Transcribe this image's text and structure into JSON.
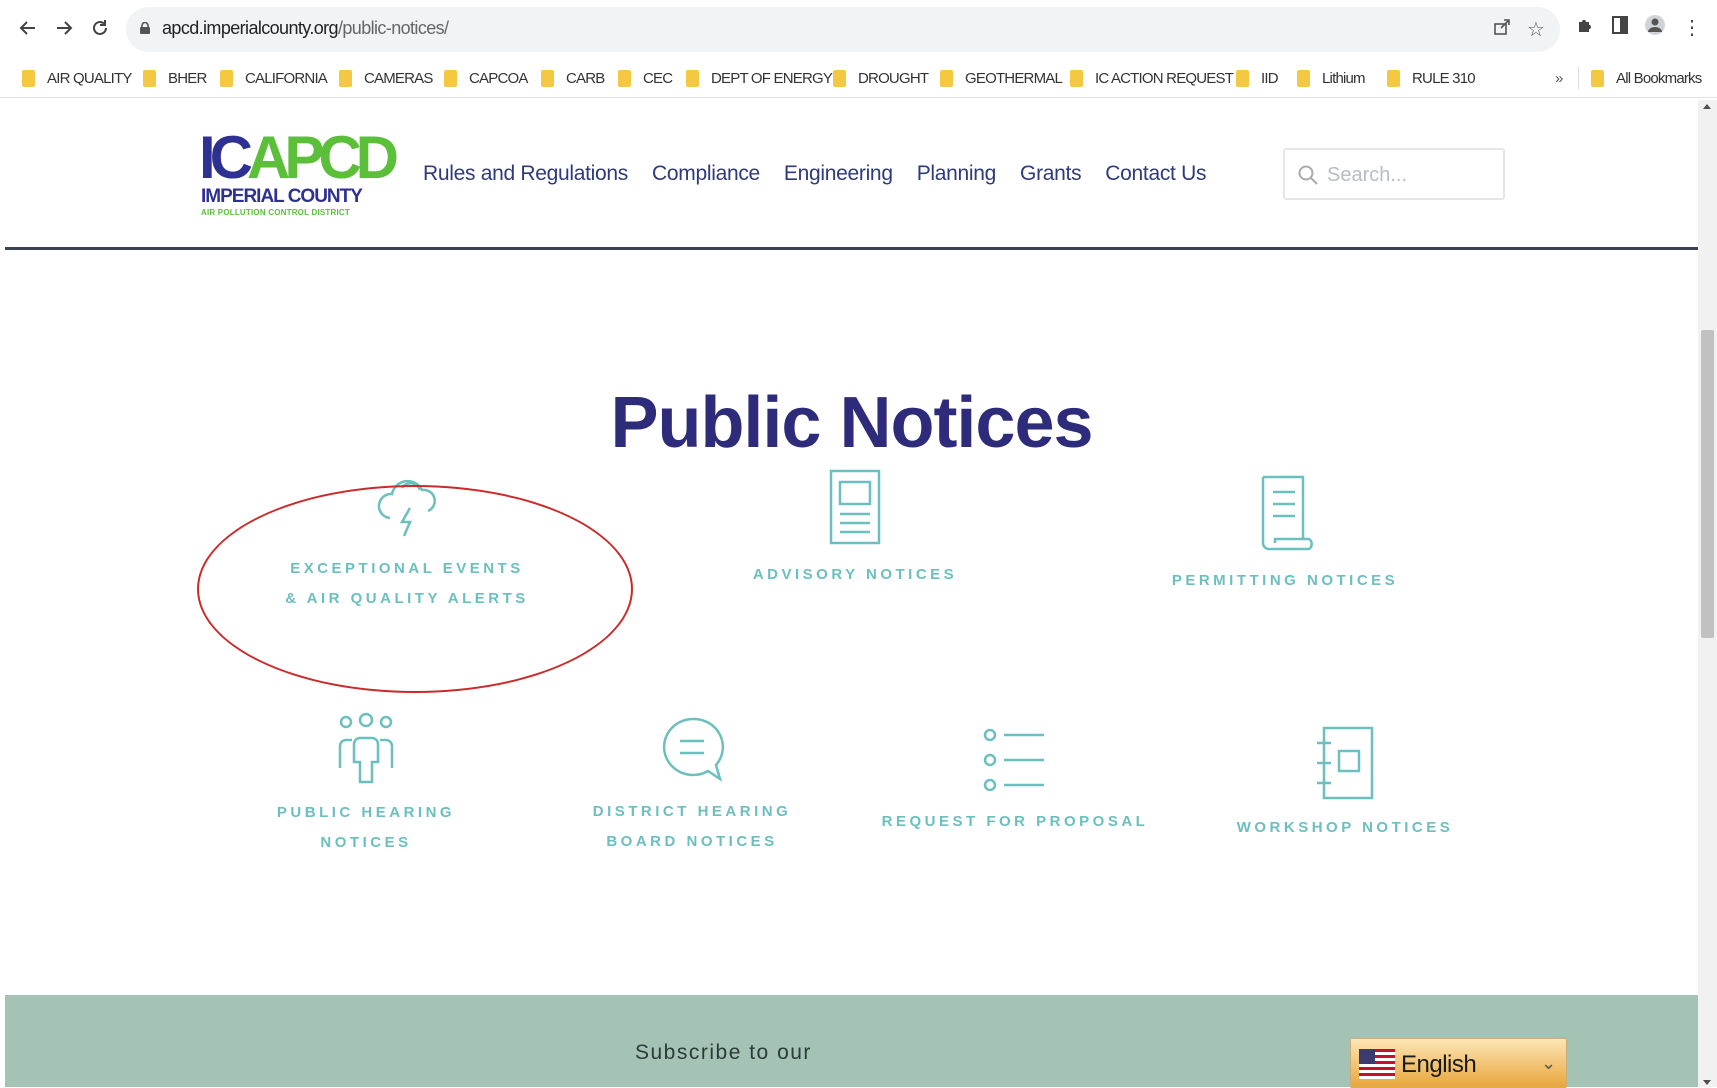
{
  "browser": {
    "url_domain": "apcd.imperialcounty.org",
    "url_path": "/public-notices/",
    "bookmarks": [
      "AIR QUALITY",
      "BHER",
      "CALIFORNIA",
      "CAMERAS",
      "CAPCOA",
      "CARB",
      "CEC",
      "DEPT OF ENERGY",
      "DROUGHT",
      "GEOTHERMAL",
      "IC ACTION REQUEST",
      "IID",
      "Lithium",
      "RULE 310"
    ],
    "overflow_label": "»",
    "all_bookmarks": "All Bookmarks"
  },
  "logo": {
    "mark_ic": "IC",
    "mark_apcd": "APCD",
    "name": "IMPERIAL COUNTY",
    "subtitle": "AIR POLLUTION CONTROL DISTRICT"
  },
  "nav": {
    "items": [
      "Rules and Regulations",
      "Compliance",
      "Engineering",
      "Planning",
      "Grants",
      "Contact Us"
    ]
  },
  "search": {
    "placeholder": "Search..."
  },
  "page": {
    "title": "Public Notices"
  },
  "notices": [
    {
      "line1": "EXCEPTIONAL EVENTS",
      "line2": "& AIR QUALITY ALERTS",
      "icon": "storm-cloud-icon"
    },
    {
      "line1": "ADVISORY NOTICES",
      "line2": "",
      "icon": "document-icon"
    },
    {
      "line1": "PERMITTING NOTICES",
      "line2": "",
      "icon": "scroll-document-icon"
    },
    {
      "line1": "PUBLIC HEARING",
      "line2": "NOTICES",
      "icon": "people-group-icon"
    },
    {
      "line1": "DISTRICT HEARING",
      "line2": "BOARD NOTICES",
      "icon": "chat-bubble-icon"
    },
    {
      "line1": "REQUEST FOR PROPOSAL",
      "line2": "",
      "icon": "list-icon"
    },
    {
      "line1": "WORKSHOP NOTICES",
      "line2": "",
      "icon": "notebook-icon"
    }
  ],
  "footer": {
    "subscribe": "Subscribe to our",
    "language": "English"
  },
  "colors": {
    "brand_navy": "#2e3192",
    "brand_green": "#5bbf3a",
    "title": "#2e2c7a",
    "notice_teal": "#6cbfbf",
    "footer_bg": "#a4c3b5",
    "highlight_red": "#cc2a2a"
  }
}
